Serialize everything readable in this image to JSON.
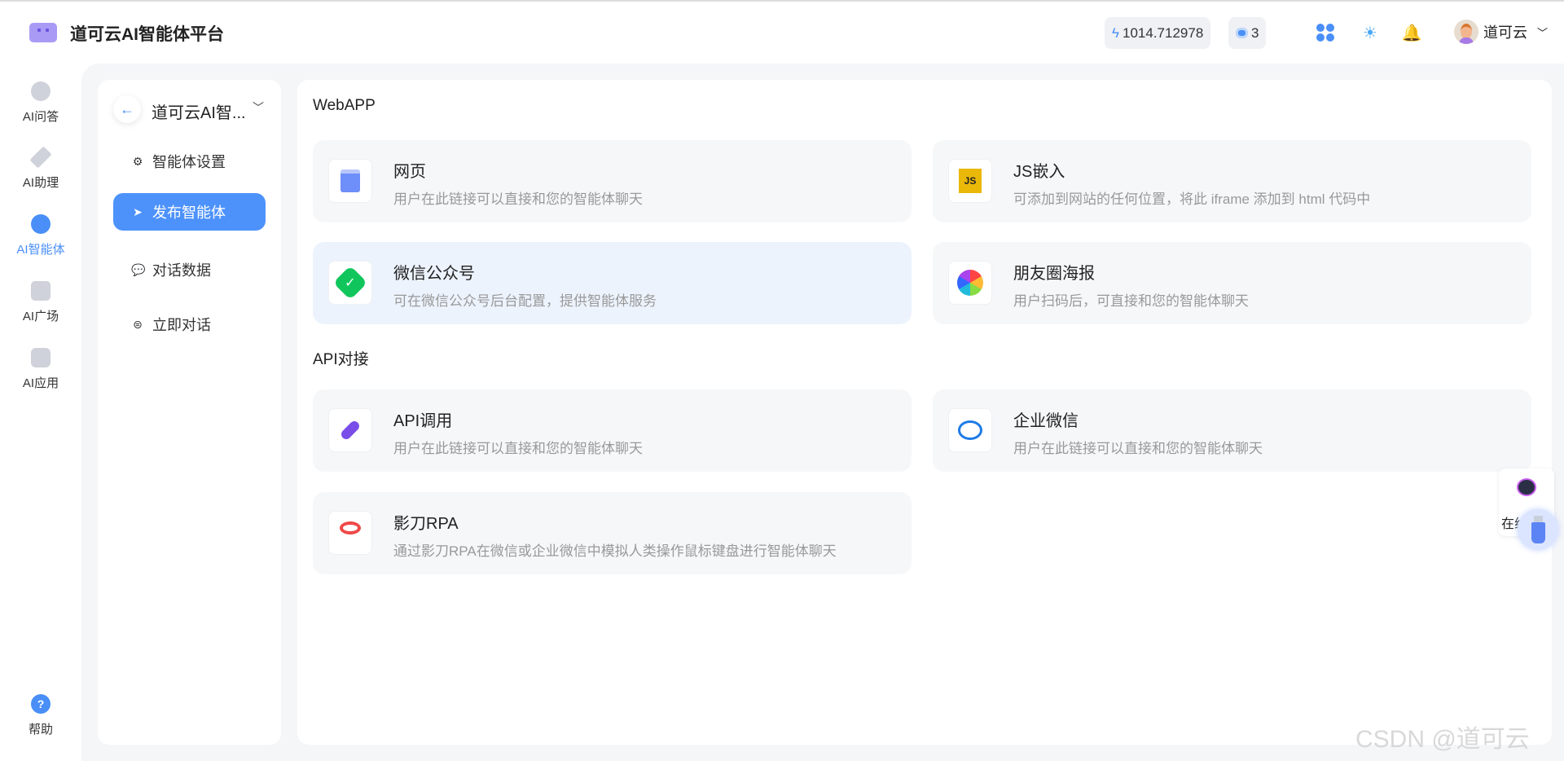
{
  "header": {
    "brand": "道可云AI智能体平台",
    "balance": "1014.712978",
    "agent_count": "3",
    "user_name": "道可云"
  },
  "nav": [
    {
      "label": "AI问答"
    },
    {
      "label": "AI助理"
    },
    {
      "label": "AI智能体",
      "active": true
    },
    {
      "label": "AI广场"
    },
    {
      "label": "AI应用"
    }
  ],
  "help_label": "帮助",
  "side": {
    "agent_name": "道可云AI智...",
    "menu": [
      {
        "label": "智能体设置",
        "icon": "gear-icon"
      },
      {
        "label": "发布智能体",
        "icon": "send-icon",
        "active": true
      },
      {
        "label": "对话数据",
        "icon": "chat-icon"
      },
      {
        "label": "立即对话",
        "icon": "message-icon"
      }
    ]
  },
  "main": {
    "section_webapp": "WebAPP",
    "section_api": "API对接",
    "cards": [
      {
        "title": "网页",
        "desc": "用户在此链接可以直接和您的智能体聊天"
      },
      {
        "title": "JS嵌入",
        "desc": "可添加到网站的任何位置，将此 iframe 添加到 html 代码中"
      },
      {
        "title": "微信公众号",
        "desc": "可在微信公众号后台配置，提供智能体服务"
      },
      {
        "title": "朋友圈海报",
        "desc": "用户扫码后，可直接和您的智能体聊天"
      },
      {
        "title": "API调用",
        "desc": "用户在此链接可以直接和您的智能体聊天"
      },
      {
        "title": "企业微信",
        "desc": "用户在此链接可以直接和您的智能体聊天"
      },
      {
        "title": "影刀RPA",
        "desc": "通过影刀RPA在微信或企业微信中模拟人类操作鼠标键盘进行智能体聊天"
      }
    ]
  },
  "float_label": "在线",
  "watermark": "CSDN @道可云",
  "colors": {
    "accent": "#4d92fb",
    "highlight_card": "#edf3fd"
  }
}
